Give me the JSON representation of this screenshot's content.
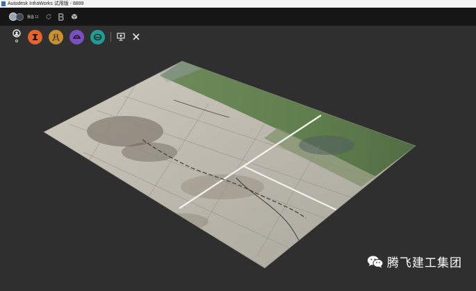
{
  "window": {
    "title": "Autodesk InfraWorks 试用版 - 8899"
  },
  "topbar": {
    "user_name": "赛昌 11"
  },
  "toolbar": {
    "tools": [
      {
        "name": "model-tool",
        "color": "#e8632b"
      },
      {
        "name": "road-tool",
        "color": "#c8902f"
      },
      {
        "name": "bridge-tool",
        "color": "#7a4fc2"
      },
      {
        "name": "drainage-tool",
        "color": "#1f9d94"
      }
    ]
  },
  "watermark": {
    "text": "腾飞建工集团"
  },
  "colors": {
    "background": "#2f2f30",
    "topbar": "#161616",
    "terrain_base": "#b9b7ae",
    "terrain_green": "#5b7a4a"
  }
}
